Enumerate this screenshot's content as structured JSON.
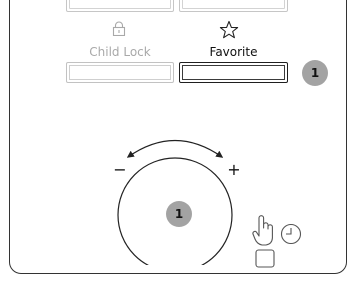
{
  "buttons": {
    "child_lock": {
      "label": "Child Lock",
      "state": "inactive",
      "icon": "lock-icon"
    },
    "favorite": {
      "label": "Favorite",
      "state": "active",
      "icon": "star-icon"
    }
  },
  "callouts": {
    "favorite": "1",
    "dial": "1"
  },
  "dial": {
    "minus_label": "−",
    "plus_label": "+"
  },
  "icons": {
    "touch": "touch-hand-icon",
    "timer": "timer-clock-icon",
    "square": "square-button-icon"
  },
  "colors": {
    "active_text": "#111111",
    "inactive_text": "#a9a9a9",
    "callout": "#a3a3a3"
  }
}
